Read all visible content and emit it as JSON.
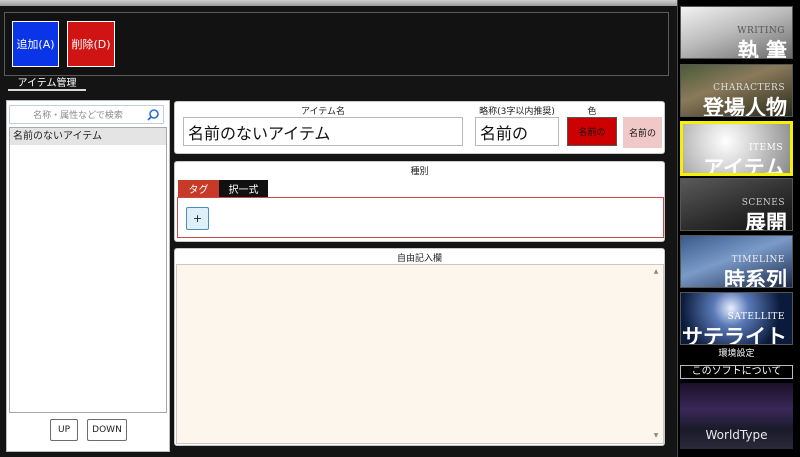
{
  "toolbar": {
    "add_label": "追加(A)",
    "delete_label": "削除(D)"
  },
  "section": {
    "title": "アイテム管理"
  },
  "search": {
    "placeholder": "名称・属性などで検索",
    "icon": "search-icon"
  },
  "item_list": {
    "items": [
      "名前のないアイテム"
    ]
  },
  "list_buttons": {
    "up": "UP",
    "down": "DOWN"
  },
  "item_form": {
    "name_label": "アイテム名",
    "name_value": "名前のないアイテム",
    "abbr_label": "略称(3字以内推奨)",
    "abbr_value": "名前の",
    "color_label": "色",
    "color_btn_1": "名前の",
    "color_btn_2": "名前の"
  },
  "type_section": {
    "title": "種別",
    "tabs": [
      "タグ",
      "択一式"
    ],
    "add_button": "+"
  },
  "memo": {
    "title": "自由記入欄"
  },
  "nav": {
    "items": [
      {
        "en": "WRITING",
        "jp": "執 筆"
      },
      {
        "en": "CHARACTERS",
        "jp": "登場人物"
      },
      {
        "en": "ITEMS",
        "jp": "アイテム"
      },
      {
        "en": "SCENES",
        "jp": "展開"
      },
      {
        "en": "TIMELINE",
        "jp": "時系列"
      },
      {
        "en": "SATELLITE",
        "jp": "サテライト"
      }
    ],
    "settings": "環境設定",
    "about": "このソフトについて",
    "brand": "WorldType"
  },
  "colors": {
    "add": "#0a34e8",
    "delete": "#d01414",
    "active_nav_border": "#f5f000",
    "tag_tab": "#c73a28",
    "color_swatch": "#cc0000",
    "color_swatch_light": "#f0c8c8",
    "memo_bg": "#fdf6ec"
  }
}
